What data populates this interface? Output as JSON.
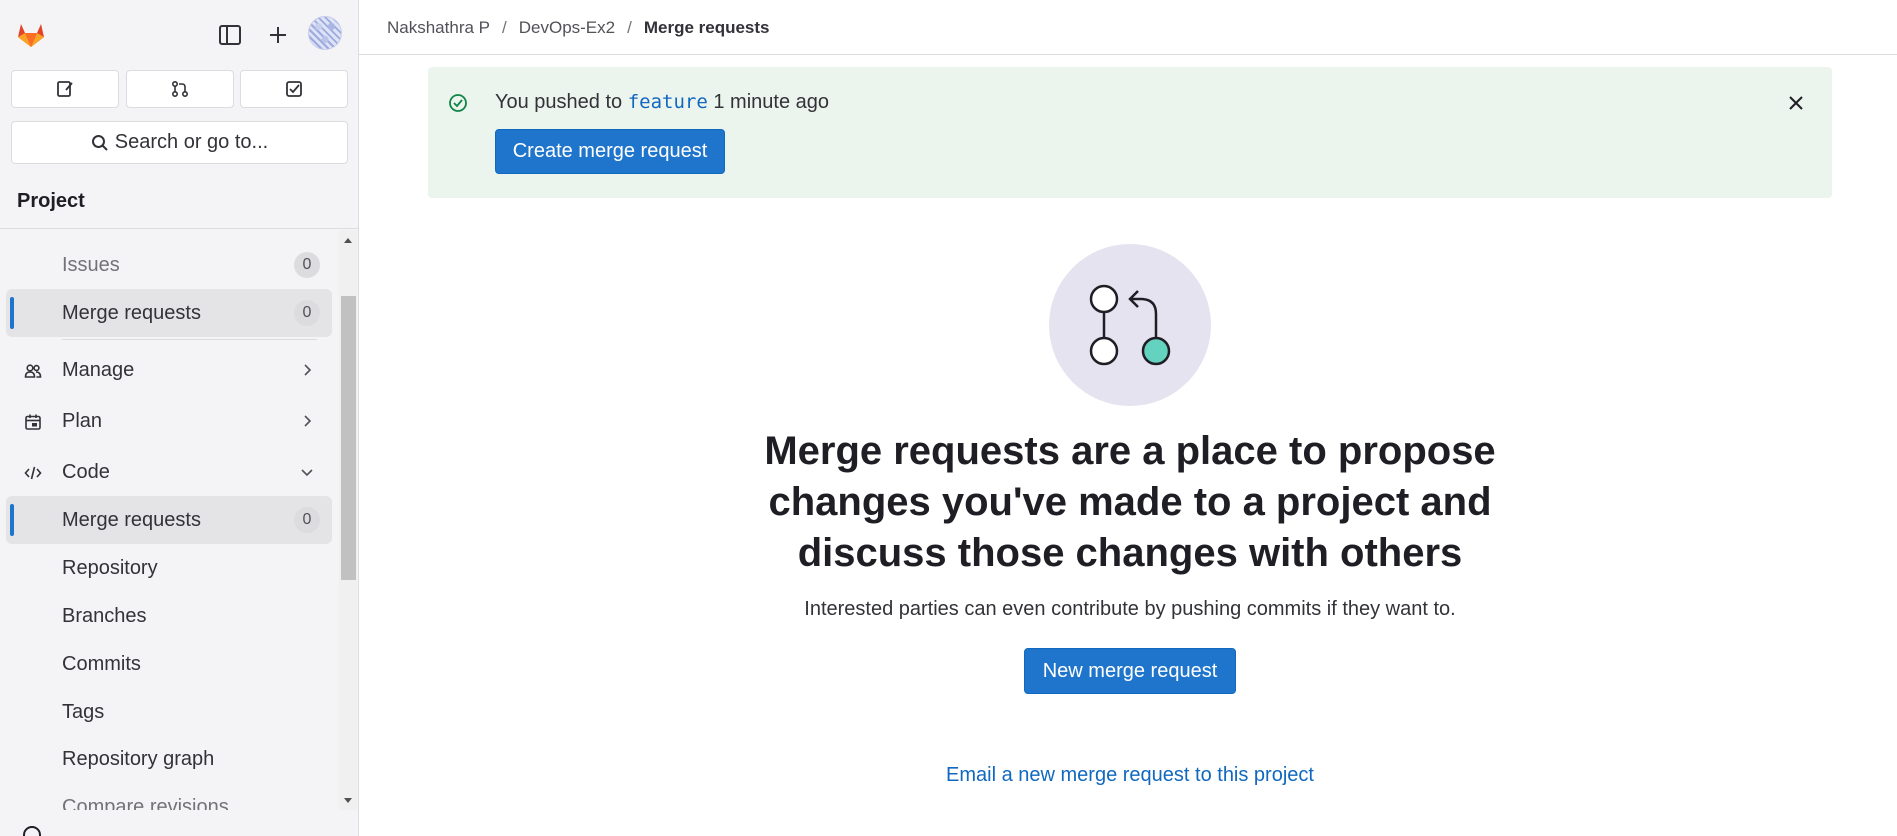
{
  "sidebar": {
    "logo_icon": "gitlab-tanuki-icon",
    "toggle_icon": "sidebar-toggle-icon",
    "new_icon": "plus-icon",
    "quick_buttons": [
      "issues-icon",
      "merge-request-icon",
      "todo-icon"
    ],
    "search_placeholder": "Search or go to...",
    "project_heading": "Project",
    "items": [
      {
        "label": "Issues",
        "badge": "0"
      },
      {
        "label": "Merge requests",
        "badge": "0"
      },
      {
        "label": "Manage",
        "icon": "users-icon"
      },
      {
        "label": "Plan",
        "icon": "calendar-icon"
      },
      {
        "label": "Code",
        "icon": "code-icon"
      },
      {
        "label": "Merge requests",
        "badge": "0"
      },
      {
        "label": "Repository"
      },
      {
        "label": "Branches"
      },
      {
        "label": "Commits"
      },
      {
        "label": "Tags"
      },
      {
        "label": "Repository graph"
      },
      {
        "label": "Compare revisions"
      }
    ]
  },
  "breadcrumb": {
    "items": [
      "Nakshathra P",
      "DevOps-Ex2",
      "Merge requests"
    ],
    "separator": "/"
  },
  "alert": {
    "prefix": "You pushed to",
    "branch": "feature",
    "suffix": "1 minute ago",
    "button": "Create merge request"
  },
  "empty_state": {
    "title": "Merge requests are a place to propose changes you've made to a project and discuss those changes with others",
    "description": "Interested parties can even contribute by pushing commits if they want to.",
    "button": "New merge request",
    "email_link": "Email a new merge request to this project"
  },
  "colors": {
    "primary": "#1f75cb",
    "alert_bg": "#ecf4ee",
    "illustration_bg": "#e5e3f0",
    "accent_teal": "#63d3c0"
  }
}
